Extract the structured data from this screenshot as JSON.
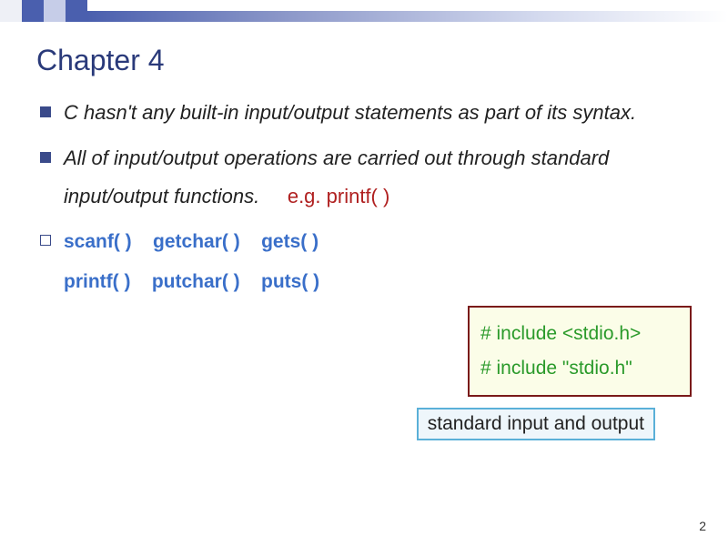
{
  "title": "Chapter 4",
  "bullets": {
    "b1": "C hasn't any built-in input/output statements as part of its syntax.",
    "b2a": "All of input/output operations are carried out through standard input/output functions.",
    "b2b": "e.g.  printf( )"
  },
  "functions": {
    "row1a": "scanf( )",
    "row1b": "getchar( )",
    "row1c": "gets( )",
    "row2a": "printf( )",
    "row2b": "putchar( )",
    "row2c": "puts( )"
  },
  "include": {
    "line1": "# include <stdio.h>",
    "line2": "# include \"stdio.h\""
  },
  "stdio_label": "standard input and output",
  "page": "2"
}
